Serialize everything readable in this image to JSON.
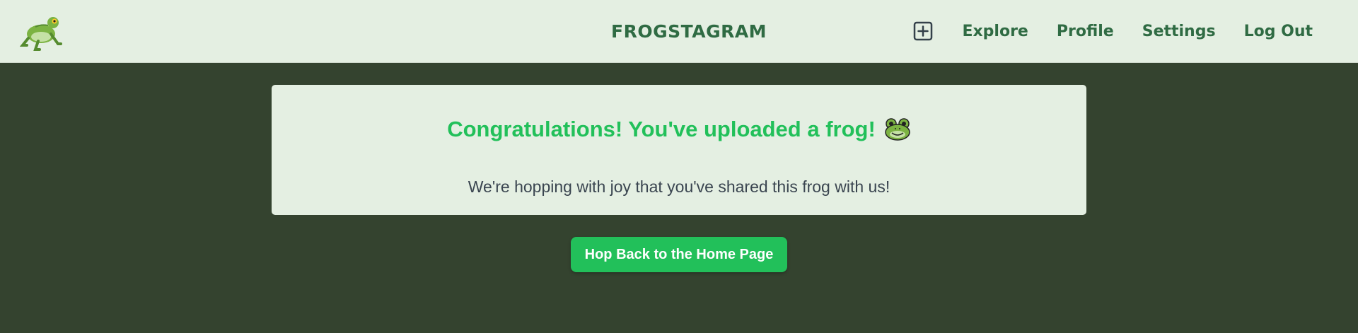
{
  "nav": {
    "brand": "FROGSTAGRAM",
    "logo_icon": "frog-logo-icon",
    "add_icon": "plus-square-icon",
    "links": [
      "Explore",
      "Profile",
      "Settings",
      "Log Out"
    ]
  },
  "card": {
    "title": "Congratulations! You've uploaded a frog!",
    "title_emoji_icon": "frog-face-icon",
    "message": "We're hopping with joy that you've shared this frog with us!"
  },
  "actions": {
    "home_button_label": "Hop Back to the Home Page"
  },
  "colors": {
    "page_background": "#34432f",
    "surface": "#e4efe2",
    "brand_green": "#2f6b43",
    "accent_green": "#22c05a",
    "body_text": "#3a4550"
  }
}
